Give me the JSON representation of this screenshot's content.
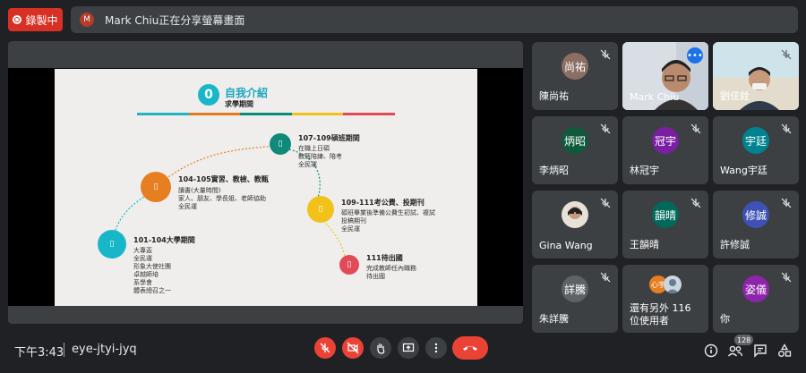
{
  "recording": {
    "label": "錄製中"
  },
  "share_banner": {
    "avatar": "M",
    "text": "Mark Chiu正在分享螢幕畫面"
  },
  "slide": {
    "number": "0",
    "title": "自我介紹",
    "subtitle": "求學期間",
    "rule_colors": [
      "#1fb3c4",
      "#e07b1f",
      "#0f8a7a",
      "#f2c21a",
      "#e24a57"
    ],
    "nodes": [
      {
        "title": "101-104大學期間",
        "lines": [
          "大專盃",
          "全民運",
          "形象大使社團",
          "卓越師培",
          "系學會",
          "體表總召之一"
        ],
        "color": "#17b7c9"
      },
      {
        "title": "104-105實習、教檢、教甄",
        "lines": [
          "讀書(大量時間)",
          "家人、朋友、學長姐、老師協助",
          "全民運"
        ],
        "color": "#e67e22"
      },
      {
        "title": "107-109碩班期間",
        "lines": [
          "在職上日碩",
          "教甄陪練、陪考",
          "全民運"
        ],
        "color": "#0f8a7a"
      },
      {
        "title": "109-111考公費、投期刊",
        "lines": [
          "碩班畢業後準備公費生初試、複試",
          "投稿期刊",
          "全民運"
        ],
        "color": "#f2c21a"
      },
      {
        "title": "111待出國",
        "lines": [
          "完成教師任內職務",
          "待出國"
        ],
        "color": "#e24a57"
      }
    ]
  },
  "participants": [
    {
      "name": "陳尚祐",
      "avatar": "尚祐",
      "color": "#8d6e63"
    },
    {
      "name": "Mark Chiu",
      "avatar": "",
      "color": ""
    },
    {
      "name": "劉佳銓",
      "avatar": "",
      "color": ""
    },
    {
      "name": "李炳昭",
      "avatar": "炳昭",
      "color": "#0f5a3c"
    },
    {
      "name": "林冠宇",
      "avatar": "冠宇",
      "color": "#7b1fa2"
    },
    {
      "name": "Wang宇廷",
      "avatar": "宇廷",
      "color": "#00838f"
    },
    {
      "name": "Gina Wang",
      "avatar": "",
      "color": ""
    },
    {
      "name": "王韻晴",
      "avatar": "韻晴",
      "color": "#00695c"
    },
    {
      "name": "許修誠",
      "avatar": "修誠",
      "color": "#3f51b5"
    },
    {
      "name": "朱詳騰",
      "avatar": "詳騰",
      "color": "#5f6368"
    },
    {
      "name": "還有另外 116 位使用者",
      "avatar": "心宇",
      "color": "#e67e22"
    },
    {
      "name": "你",
      "avatar": "姿儀",
      "color": "#8e24aa"
    }
  ],
  "bottom_bar": {
    "time": "下午3:43",
    "meeting_code": "eye-jtyi-jyq",
    "participant_count": "128"
  },
  "colors": {
    "background": "#202124",
    "tile": "#3c4043",
    "danger": "#ea4335",
    "accent": "#1a73e8"
  }
}
